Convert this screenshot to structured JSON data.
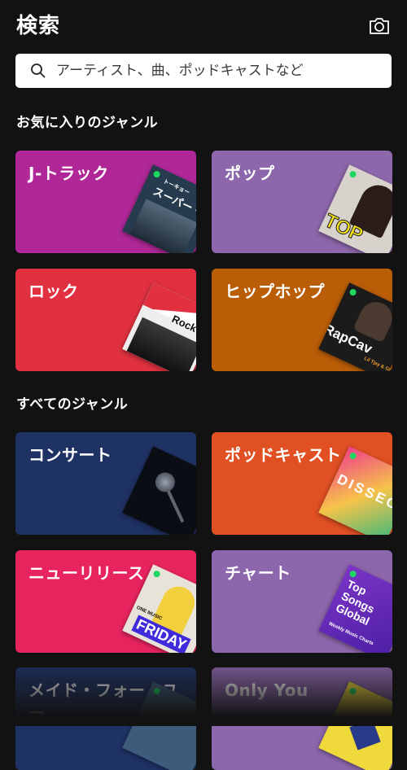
{
  "header": {
    "title": "検索",
    "camera_icon": "camera-icon"
  },
  "search": {
    "placeholder": "アーティスト、曲、ポッドキャストなど",
    "icon": "search-icon"
  },
  "sections": {
    "favorites": "お気に入りのジャンル",
    "all": "すべてのジャンル"
  },
  "favorites": [
    {
      "label": "J-トラック",
      "color": "#b02897",
      "art_text": "スーパー・ビ",
      "art_sub": "トーキョー"
    },
    {
      "label": "ポップ",
      "color": "#8d67ab",
      "art_text": "TOP",
      "art_sub": ""
    },
    {
      "label": "ロック",
      "color": "#e13140",
      "art_text": "Rock T",
      "art_sub": ""
    },
    {
      "label": "ヒップホップ",
      "color": "#ba5d07",
      "art_text": "RapCav",
      "art_sub": "Lil Tjay & Glock"
    }
  ],
  "genres": [
    {
      "label": "コンサート",
      "color": "#1f3264",
      "art_text": "",
      "art_sub": ""
    },
    {
      "label": "ポッドキャスト",
      "color": "#e05023",
      "art_text": "DISSEC",
      "art_sub": ""
    },
    {
      "label": "ニューリリース",
      "color": "#e8245f",
      "art_text": "FRIDAY",
      "art_sub": "ONE MUSIC"
    },
    {
      "label": "チャート",
      "color": "#8d67ab",
      "art_text": "Top Songs Global",
      "art_sub": "Weekly Music Charts"
    },
    {
      "label": "メイド・フォー・ユー",
      "color": "#1e3264",
      "art_text": "",
      "art_sub": ""
    },
    {
      "label": "Only You",
      "color": "#8c67ab",
      "art_text": "",
      "art_sub": ""
    }
  ]
}
